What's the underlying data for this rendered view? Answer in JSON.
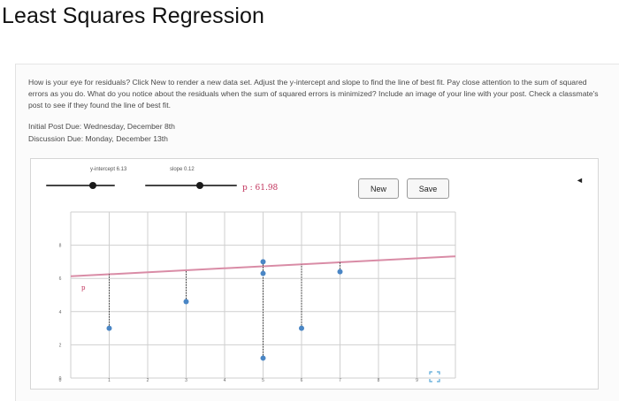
{
  "page": {
    "title": "Least Squares Regression",
    "prompt": "How is your eye for residuals? Click New to render a new data set. Adjust the y-intercept and slope to find the line of best fit. Pay close attention to the sum of squared errors as you do. What do you notice about the residuals when the sum of squared errors is minimized? Include an image of your line with your post. Check a classmate's post to see if they found the line of best fit.",
    "initial_due": "Initial Post Due: Wednesday, December 8th",
    "discussion_due": "Discussion Due: Monday, December 13th"
  },
  "controls": {
    "intercept_label": "y-intercept 6.13",
    "slope_label": "slope 0.12",
    "intercept_level": 0.68,
    "slope_level": 0.6,
    "sse_text": "p : 61.98",
    "new_label": "New",
    "save_label": "Save"
  },
  "plot": {
    "corner_label": "p",
    "y_tick_labels": [
      "8",
      "6",
      "4",
      "2",
      "0"
    ],
    "x_tick_labels": [
      "1",
      "2",
      "3",
      "4",
      "5",
      "6",
      "7",
      "8",
      "9"
    ],
    "xlim": [
      0,
      10
    ],
    "ylim": [
      0,
      10
    ],
    "intercept": 6.13,
    "slope": 0.12,
    "points": [
      {
        "x": 1,
        "y": 3
      },
      {
        "x": 3,
        "y": 4.6
      },
      {
        "x": 5,
        "y": 7
      },
      {
        "x": 5,
        "y": 6.3
      },
      {
        "x": 5,
        "y": 1.2
      },
      {
        "x": 6,
        "y": 3
      },
      {
        "x": 7,
        "y": 6.4
      }
    ],
    "line_color": "#d98ca6",
    "point_color": "#4a86c5",
    "residual_color": "#333333"
  }
}
